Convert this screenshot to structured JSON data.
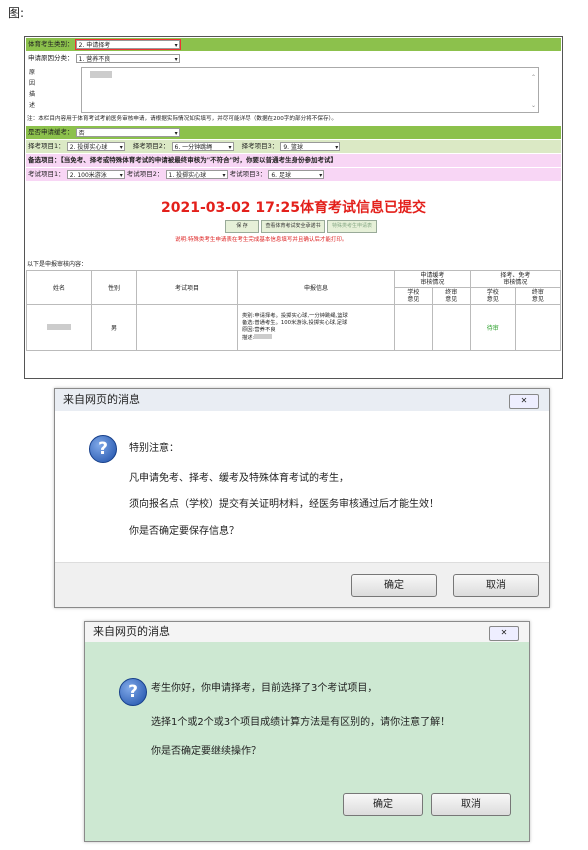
{
  "caption": "图:",
  "form": {
    "type_label": "体育考生类别：",
    "type_value": "2. 申请择考",
    "reason_cat_label": "申请原因分类：",
    "reason_cat_value": "1. 营养不良",
    "detail_label_chars": [
      "原",
      "因",
      "描",
      "述"
    ],
    "note": "注：本栏目内容用于体育考试考前医务审核申请，请根据实际情况如实填写，并尽可能详尽（数据在200字的部分将不保存）。",
    "need_cert_label": "是否申请缓考：",
    "need_cert_value": "否",
    "choice1_label": "择考项目1：",
    "choice1_value": "2. 投掷实心球",
    "choice2_label": "择考项目2：",
    "choice2_value": "6. 一分钟跳绳",
    "choice3_label": "择考项目3：",
    "choice3_value": "9. 篮球",
    "pink_note_bold": "备选项目：",
    "pink_note": "【当免考、择考或特殊体育考试的申请被最终审核为\"不符合\"时，你要以普通考生身份参加考试】",
    "exam1_label": "考试项目1：",
    "exam1_value": "2. 100米游泳",
    "exam2_label": "考试项目2：",
    "exam2_value": "1. 投掷实心球",
    "exam3_label": "考试项目3：",
    "exam3_value": "6. 足球",
    "submitted_title": "2021-03-02 17:25体育考试信息已提交",
    "buttons": [
      "保 存",
      "查看体育考试安全承诺书",
      "特殊类考生申请表"
    ],
    "red_note": "说明:特殊类考生申请表在考生完成基本信息填写并且确认后才能打印。",
    "list_title": "以下是申报审核内容：",
    "table": {
      "h_name": "姓名",
      "h_gender": "性别",
      "h_exam": "考试项目",
      "h_info": "申报信息",
      "h_group1": "申请缓考\n审核情况",
      "h_group2": "择考、免考\n审核情况",
      "h_school1": "学校\n意见",
      "h_final1": "终审\n意见",
      "h_school2": "学校\n意见",
      "h_final2": "终审\n意见",
      "gender": "男",
      "info_lines": [
        "类别:申请择考。投掷实心球,一分钟跳绳,篮球",
        "备选:普通考生。100米游泳,投掷实心球,足球",
        "原因:营养不良",
        "描述:"
      ],
      "school2_status": "待审"
    }
  },
  "dialog1": {
    "title": "来自网页的消息",
    "close": "✕",
    "heading": "特别注意：",
    "line1": "凡申请免考、择考、缓考及特殊体育考试的考生，",
    "line2": "须向报名点（学校）提交有关证明材料，经医务审核通过后才能生效！",
    "line3": "你是否确定要保存信息？",
    "ok": "确定",
    "cancel": "取消"
  },
  "dialog2": {
    "title": "来自网页的消息",
    "close": "✕",
    "line1": "考生你好，你申请择考，目前选择了3个考试项目，",
    "line2": "选择1个或2个或3个项目成绩计算方法是有区别的，请你注意了解！",
    "line3": "你是否确定要继续操作？",
    "ok": "确定",
    "cancel": "取消"
  },
  "colors": {
    "green_bar": "#8cc14c",
    "pink_bar": "#f8d6f5",
    "title_red": "#e3201b",
    "dialog2_bg": "#cde8d2",
    "pending_green": "#2aa02a"
  }
}
